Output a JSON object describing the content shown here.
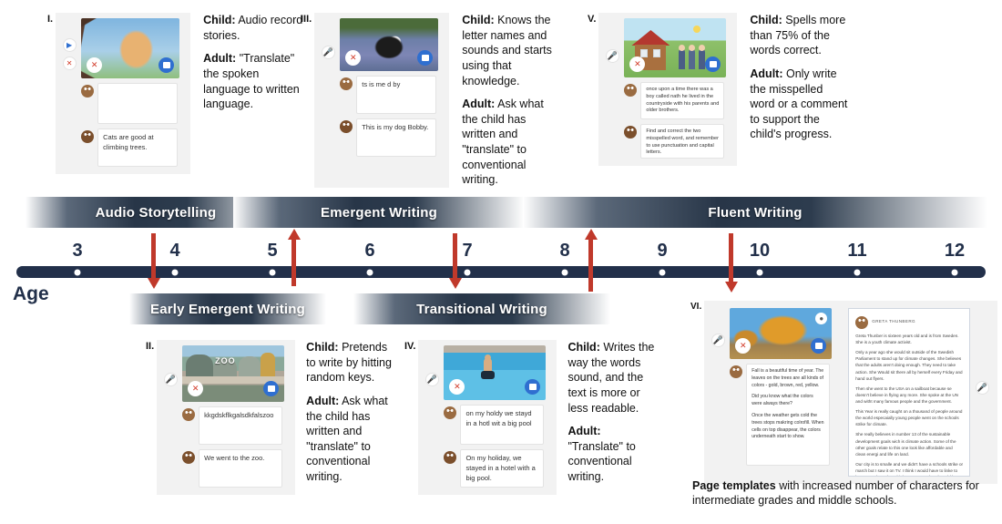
{
  "timeline": {
    "age_label": "Age",
    "ticks": [
      "3",
      "4",
      "5",
      "6",
      "7",
      "8",
      "9",
      "10",
      "11",
      "12"
    ],
    "top_bands": [
      {
        "label": "Audio Storytelling"
      },
      {
        "label": "Emergent Writing"
      },
      {
        "label": "Fluent Writing"
      }
    ],
    "bottom_bands": [
      {
        "label": "Early Emergent Writing"
      },
      {
        "label": "Transitional Writing"
      }
    ],
    "accent_color": "#c0392b",
    "axis_color": "#22304a"
  },
  "panels": {
    "p1": {
      "roman": "I.",
      "notes": [
        "",
        "Cats are good at climbing trees."
      ],
      "child_label": "Child:",
      "child_text": " Audio record stories.",
      "adult_label": "Adult:",
      "adult_text": " \"Translate\" the spoken language to written language."
    },
    "p2": {
      "roman": "II.",
      "notes": [
        "kkgdskflkgalsdkfalszoo",
        "We went to the zoo."
      ],
      "image_word": "ZOO",
      "child_label": "Child:",
      "child_text": " Pretends to write by hitting random keys.",
      "adult_label": "Adult:",
      "adult_text": " Ask what the child has written and \"translate\" to conventional writing."
    },
    "p3": {
      "roman": "III.",
      "notes": [
        "ts is me d by",
        "This is my dog Bobby."
      ],
      "child_label": "Child:",
      "child_text": " Knows the letter names and sounds and starts using that knowledge.",
      "adult_label": "Adult:",
      "adult_text": " Ask what the child has written and \"translate\" to conventional writing."
    },
    "p4": {
      "roman": "IV.",
      "notes": [
        "on my holdy we stayd in a hotl wit a big pool",
        "On my holiday, we stayed in a hotel with a big pool."
      ],
      "child_label": "Child:",
      "child_text": " Writes the way the words sound, and the text is more or less readable.",
      "adult_label": "Adult:",
      "adult_text": " \"Translate\" to conventional writing."
    },
    "p5": {
      "roman": "V.",
      "notes": [
        "once upon a time there was a boy called nath he lived in the countryside with his parents and older brothers.",
        "Find and correct the two misspelled word, and remember to use punctuation and capital letters."
      ],
      "child_label": "Child:",
      "child_text": " Spells more than 75% of the words correct.",
      "adult_label": "Adult:",
      "adult_text": " Only write the misspelled word or a comment to support the child's progress."
    },
    "p6": {
      "roman": "VI.",
      "fall_paragraphs": [
        "Fall is a beautiful time of year. The leaves on the trees are all kinds of colors - gold, brown, red, yellow.",
        "Did you know what the colors were always there?",
        "Once the weather gets cold the trees stops makring colrofill. When cells on top disappear, the colors underneath start to show."
      ],
      "doc_title": "GRETA THUNBERG",
      "doc_paragraphs": [
        "Greta Thunber is sixteen years old and is from Sweden. She is a youth climate activist.",
        "Only a year ago she would sit outside of the Swedish Parliament to stand up for climate changes. She believes that the adults aren't doing enough. They need to take action. She Would sit there all by herself every Friday and hand out flyers.",
        "Then she went to the USA on a sailboat because se doesn't believe in flying any more. She spoke at the UN and witht many famous people and the government.",
        "This Year is really caught on a thousand of people around the world especaially young people went on the schools strike for climate.",
        "She really believes in number 13 of the sustainable development goals wich is climate action. Some of the other goals relate to this one look like affordable and clean energi and life on land.",
        "Our city is to smalle and we didn't have a schools strike or march but I saw it on TV. I think I would have to linke to have gone but I don't think my Mom and Dad would have let me skip school. I don't know we didn't really talk about it."
      ],
      "footnote_bold": "Page templates",
      "footnote_rest": " with increased number of characters for intermediate grades and middle schools."
    }
  }
}
